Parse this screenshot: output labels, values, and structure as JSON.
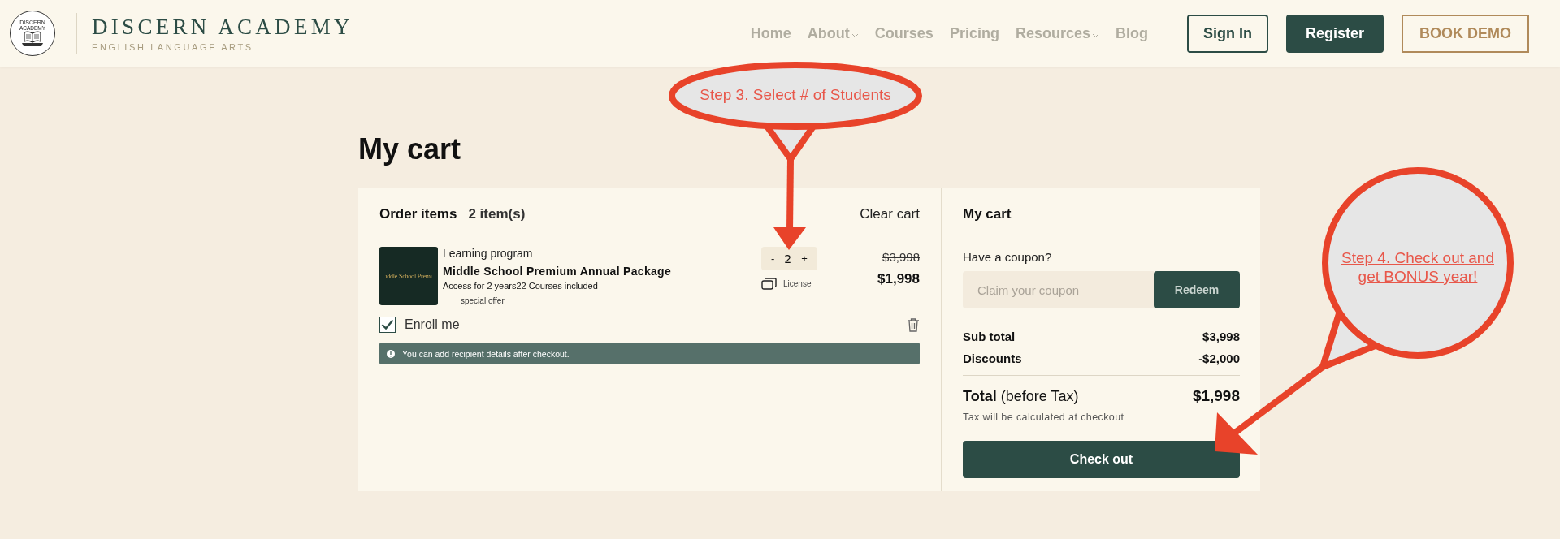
{
  "header": {
    "logo": {
      "top": "DISCERN",
      "bottom": "ACADEMY"
    },
    "brand": "DISCERN ACADEMY",
    "tagline": "ENGLISH LANGUAGE ARTS",
    "nav": [
      {
        "label": "Home",
        "dropdown": false
      },
      {
        "label": "About",
        "dropdown": true
      },
      {
        "label": "Courses",
        "dropdown": false
      },
      {
        "label": "Pricing",
        "dropdown": false
      },
      {
        "label": "Resources",
        "dropdown": true
      },
      {
        "label": "Blog",
        "dropdown": false
      }
    ],
    "buttons": [
      {
        "label": "Sign In",
        "kind": "outline"
      },
      {
        "label": "Register",
        "kind": "solid"
      },
      {
        "label": "BOOK DEMO",
        "kind": "accent"
      }
    ]
  },
  "page_title": "My cart",
  "order": {
    "title": "Order items",
    "count": "2 item(s)",
    "clear": "Clear cart",
    "items": [
      {
        "type": "Learning program",
        "name": "Middle School Premium Annual Package",
        "thumbnail_text": "iddle School Premi",
        "details": [
          "Access for 2 years",
          "22 Courses included"
        ],
        "tag": "special offer",
        "minus": "-",
        "quantity": "2",
        "plus": "+",
        "license": "License",
        "original_price": "$3,998",
        "price": "$1,998",
        "enroll": {
          "label": "Enroll me",
          "checked": true
        },
        "notice": "You can add recipient details after checkout."
      }
    ]
  },
  "summary": {
    "title": "My cart",
    "coupon_label": "Have a coupon?",
    "coupon": {
      "placeholder": "Claim your coupon"
    },
    "redeem": "Redeem",
    "lines": [
      {
        "label": "Sub total",
        "value": "$3,998"
      },
      {
        "label": "Discounts",
        "value": "-$2,000"
      }
    ],
    "total": {
      "label": "Total",
      "note": "(before Tax)",
      "value": "$1,998"
    },
    "tax_note": "Tax will be calculated at checkout",
    "checkout": "Check out"
  },
  "annotations": [
    {
      "text": "Step 3. Select # of Students"
    },
    {
      "text": "Step 4. Check out and get BONUS year!"
    }
  ]
}
